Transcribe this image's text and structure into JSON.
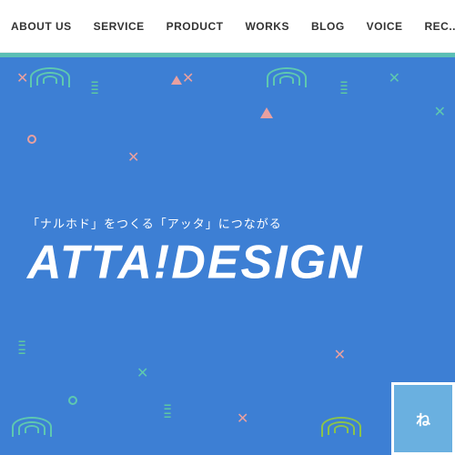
{
  "navbar": {
    "items": [
      {
        "label": "ABOUT US",
        "id": "about-us"
      },
      {
        "label": "SERVICE",
        "id": "service"
      },
      {
        "label": "PRODUCT",
        "id": "product"
      },
      {
        "label": "WORKS",
        "id": "works"
      },
      {
        "label": "BLOG",
        "id": "blog"
      },
      {
        "label": "VOICE",
        "id": "voice"
      },
      {
        "label": "REC...",
        "id": "rec"
      }
    ]
  },
  "hero": {
    "subtitle": "「ナルホド」をつくる「アッタ」につながる",
    "title": "ATTA!DESiGN",
    "cta_label": "ね"
  }
}
